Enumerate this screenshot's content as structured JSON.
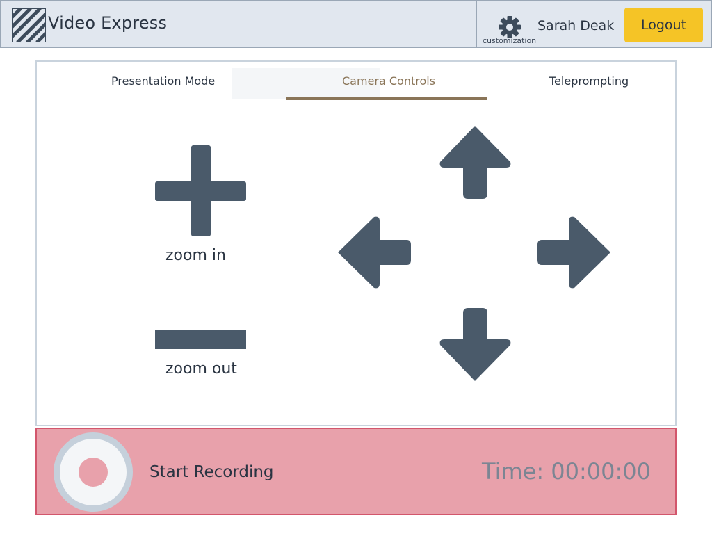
{
  "header": {
    "app_title": "Video Express",
    "customization_label": "customization",
    "user_name": "Sarah Deak",
    "logout_label": "Logout"
  },
  "tabs": [
    {
      "label": "Presentation Mode",
      "active": false
    },
    {
      "label": "Camera Controls",
      "active": true
    },
    {
      "label": "Teleprompting",
      "active": false
    }
  ],
  "camera": {
    "zoom_in_label": "zoom in",
    "zoom_out_label": "zoom out"
  },
  "recording": {
    "start_label": "Start Recording",
    "time_text": "Time: 00:00:00"
  },
  "colors": {
    "header_bg": "#e1e7ef",
    "accent_yellow": "#f5c426",
    "active_tab": "#8a7558",
    "control_icon": "#4a5a6a",
    "record_bar": "#e8a1ab",
    "record_border": "#d2566c"
  },
  "icons": [
    "logo-stripes-icon",
    "gear-icon",
    "plus-icon",
    "minus-icon",
    "arrow-up-icon",
    "arrow-left-icon",
    "arrow-right-icon",
    "arrow-down-icon",
    "record-icon"
  ]
}
